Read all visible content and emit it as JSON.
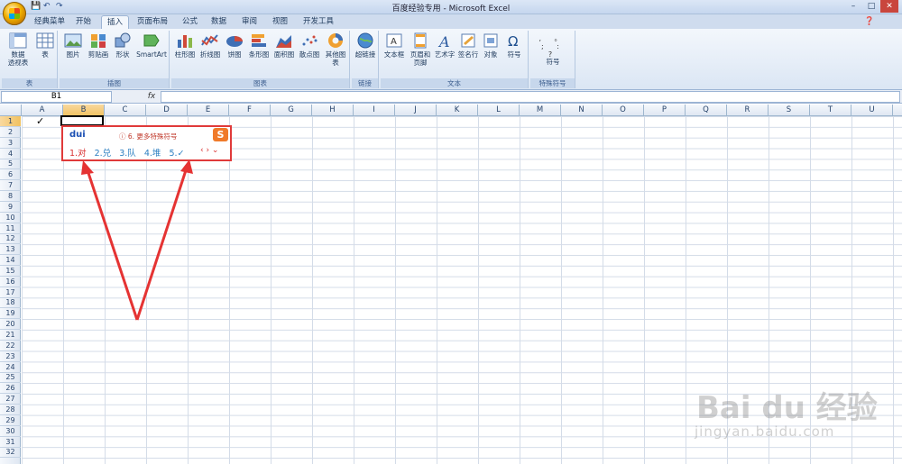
{
  "window": {
    "title": "百度经验专用 - Microsoft Excel",
    "controls": [
      "–",
      "□",
      "✕"
    ]
  },
  "qat": {
    "save": "💾",
    "undo": "↶",
    "redo": "↷"
  },
  "tabs": [
    {
      "label": "经典菜单"
    },
    {
      "label": "开始"
    },
    {
      "label": "插入"
    },
    {
      "label": "页面布局"
    },
    {
      "label": "公式"
    },
    {
      "label": "数据"
    },
    {
      "label": "审阅"
    },
    {
      "label": "视图"
    },
    {
      "label": "开发工具"
    }
  ],
  "active_tab": "插入",
  "ribbon": {
    "groups": [
      {
        "label": "表",
        "buttons": [
          {
            "label": "数据\n透视表"
          },
          {
            "label": "表"
          }
        ]
      },
      {
        "label": "插图",
        "buttons": [
          {
            "label": "图片"
          },
          {
            "label": "剪贴画"
          },
          {
            "label": "形状"
          },
          {
            "label": "SmartArt"
          }
        ]
      },
      {
        "label": "图表",
        "buttons": [
          {
            "label": "柱形图"
          },
          {
            "label": "折线图"
          },
          {
            "label": "饼图"
          },
          {
            "label": "条形图"
          },
          {
            "label": "面积图"
          },
          {
            "label": "散点图"
          },
          {
            "label": "其他图表"
          }
        ]
      },
      {
        "label": "链接",
        "buttons": [
          {
            "label": "超链接"
          }
        ]
      },
      {
        "label": "文本",
        "buttons": [
          {
            "label": "文本框"
          },
          {
            "label": "页眉和\n页脚"
          },
          {
            "label": "艺术字"
          },
          {
            "label": "签名行"
          },
          {
            "label": "对象"
          },
          {
            "label": "符号"
          }
        ]
      },
      {
        "label": "特殊符号",
        "buttons": [
          {
            "label": "符号"
          }
        ]
      }
    ]
  },
  "formula_bar": {
    "name_box": "B1",
    "fx": "fx",
    "value": ""
  },
  "columns": [
    "A",
    "B",
    "C",
    "D",
    "E",
    "F",
    "G",
    "H",
    "I",
    "J",
    "K",
    "L",
    "M",
    "N",
    "O",
    "P",
    "Q",
    "R",
    "S",
    "T",
    "U",
    "V"
  ],
  "selected_column": "B",
  "rows": [
    "1",
    "2",
    "3",
    "4",
    "5",
    "6",
    "7",
    "8",
    "9",
    "10",
    "11",
    "12",
    "13",
    "14",
    "15",
    "16",
    "17",
    "18",
    "19",
    "20",
    "21",
    "22",
    "23",
    "24",
    "25",
    "26",
    "27",
    "28",
    "29",
    "30",
    "31",
    "32"
  ],
  "selected_row": "1",
  "cell_A1": "✓",
  "ime": {
    "input": "dui",
    "hint": "6. 更多特殊符号",
    "logo": "S",
    "candidates": [
      "1.对",
      "2.兑",
      "3.队",
      "4.堆",
      "5.✓"
    ],
    "nav": "‹ › ⌄"
  },
  "watermark": {
    "logo": "Bai du 经验",
    "url": "jingyan.baidu.com"
  }
}
